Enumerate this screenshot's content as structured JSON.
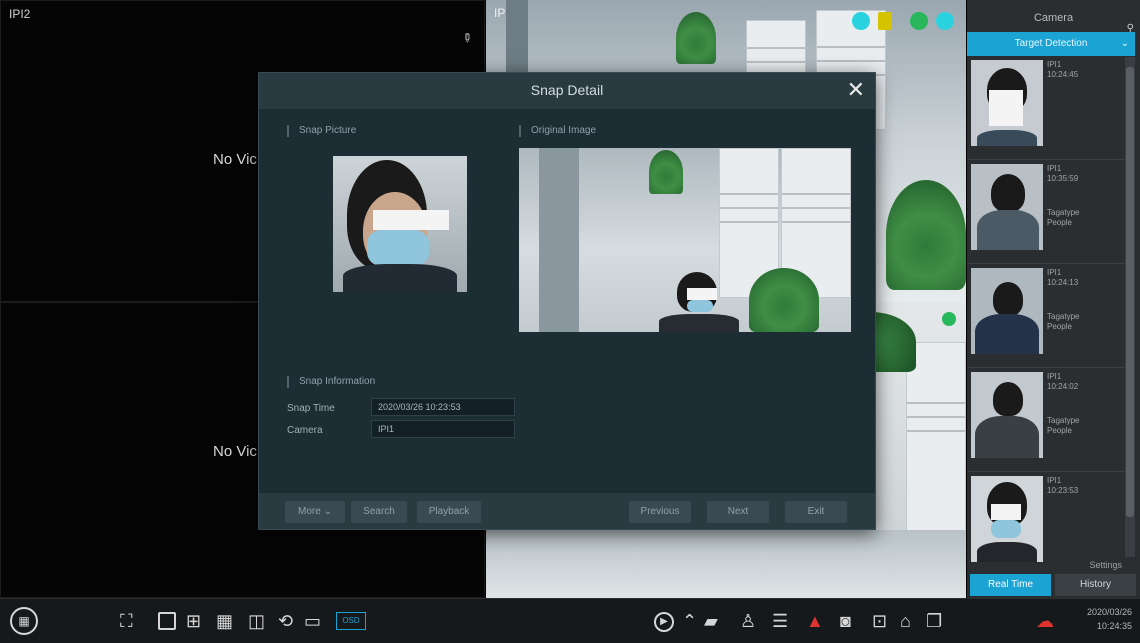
{
  "channels": {
    "top_left": {
      "label": "IPI2",
      "no_video": "No Vic"
    },
    "bottom_left": {
      "no_video": "No Vic"
    },
    "top_right_label": "IPI1"
  },
  "right_panel": {
    "title": "Camera",
    "tab": "Target Detection",
    "items": [
      {
        "camera": "IPI1",
        "time": "10:24:45",
        "type_label": "",
        "type_value": ""
      },
      {
        "camera": "IPI1",
        "time": "10:35:59",
        "type_label": "Tagatype",
        "type_value": "People"
      },
      {
        "camera": "IPI1",
        "time": "10:24:13",
        "type_label": "Tagatype",
        "type_value": "People"
      },
      {
        "camera": "IPI1",
        "time": "10:24:02",
        "type_label": "Tagatype",
        "type_value": "People"
      },
      {
        "camera": "IPI1",
        "time": "10:23:53",
        "type_label": "",
        "type_value": ""
      }
    ],
    "settings_label": "Settings",
    "real_time_button": "Real Time",
    "history_button": "History"
  },
  "dialog": {
    "title": "Snap Detail",
    "close_glyph": "✕",
    "snap_picture_label": "Snap Picture",
    "original_image_label": "Original Image",
    "snap_information_label": "Snap Information",
    "snap_time_label": "Snap Time",
    "snap_time_value": "2020/03/26 10:23:53",
    "camera_label": "Camera",
    "camera_value": "IPI1",
    "buttons": {
      "more": "More",
      "search": "Search",
      "playback": "Playback",
      "previous": "Previous",
      "next": "Next",
      "exit": "Exit"
    }
  },
  "taskbar": {
    "osd_label": "OSD",
    "clock_date": "2020/03/26",
    "clock_time": "10:24:35",
    "icons": [
      "start-menu-icon",
      "fullscreen-icon",
      "layout-1-icon",
      "layout-4-icon",
      "layout-9-icon",
      "picture-icon",
      "sequence-icon",
      "playback-icon",
      "chevron-up-icon",
      "ptz-camera-icon",
      "user-icon",
      "record-list-icon",
      "alarm-icon",
      "snapshot-icon",
      "network-icon",
      "windows-icon",
      "cloud-icon"
    ]
  },
  "colors": {
    "accent": "#1aa3d3",
    "dialog_bg": "#1d2d34",
    "panel_bg": "#2b2e31"
  }
}
